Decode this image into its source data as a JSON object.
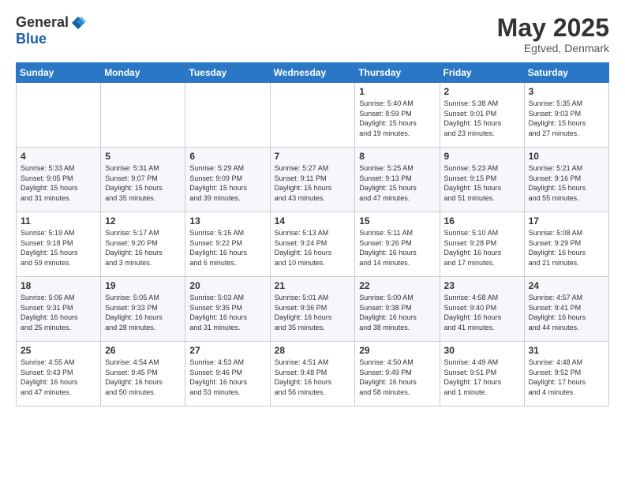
{
  "logo": {
    "general": "General",
    "blue": "Blue"
  },
  "title": {
    "month": "May 2025",
    "location": "Egtved, Denmark"
  },
  "headers": [
    "Sunday",
    "Monday",
    "Tuesday",
    "Wednesday",
    "Thursday",
    "Friday",
    "Saturday"
  ],
  "weeks": [
    [
      {
        "day": "",
        "info": ""
      },
      {
        "day": "",
        "info": ""
      },
      {
        "day": "",
        "info": ""
      },
      {
        "day": "",
        "info": ""
      },
      {
        "day": "1",
        "info": "Sunrise: 5:40 AM\nSunset: 8:59 PM\nDaylight: 15 hours\nand 19 minutes."
      },
      {
        "day": "2",
        "info": "Sunrise: 5:38 AM\nSunset: 9:01 PM\nDaylight: 15 hours\nand 23 minutes."
      },
      {
        "day": "3",
        "info": "Sunrise: 5:35 AM\nSunset: 9:03 PM\nDaylight: 15 hours\nand 27 minutes."
      }
    ],
    [
      {
        "day": "4",
        "info": "Sunrise: 5:33 AM\nSunset: 9:05 PM\nDaylight: 15 hours\nand 31 minutes."
      },
      {
        "day": "5",
        "info": "Sunrise: 5:31 AM\nSunset: 9:07 PM\nDaylight: 15 hours\nand 35 minutes."
      },
      {
        "day": "6",
        "info": "Sunrise: 5:29 AM\nSunset: 9:09 PM\nDaylight: 15 hours\nand 39 minutes."
      },
      {
        "day": "7",
        "info": "Sunrise: 5:27 AM\nSunset: 9:11 PM\nDaylight: 15 hours\nand 43 minutes."
      },
      {
        "day": "8",
        "info": "Sunrise: 5:25 AM\nSunset: 9:13 PM\nDaylight: 15 hours\nand 47 minutes."
      },
      {
        "day": "9",
        "info": "Sunrise: 5:23 AM\nSunset: 9:15 PM\nDaylight: 15 hours\nand 51 minutes."
      },
      {
        "day": "10",
        "info": "Sunrise: 5:21 AM\nSunset: 9:16 PM\nDaylight: 15 hours\nand 55 minutes."
      }
    ],
    [
      {
        "day": "11",
        "info": "Sunrise: 5:19 AM\nSunset: 9:18 PM\nDaylight: 15 hours\nand 59 minutes."
      },
      {
        "day": "12",
        "info": "Sunrise: 5:17 AM\nSunset: 9:20 PM\nDaylight: 16 hours\nand 3 minutes."
      },
      {
        "day": "13",
        "info": "Sunrise: 5:15 AM\nSunset: 9:22 PM\nDaylight: 16 hours\nand 6 minutes."
      },
      {
        "day": "14",
        "info": "Sunrise: 5:13 AM\nSunset: 9:24 PM\nDaylight: 16 hours\nand 10 minutes."
      },
      {
        "day": "15",
        "info": "Sunrise: 5:11 AM\nSunset: 9:26 PM\nDaylight: 16 hours\nand 14 minutes."
      },
      {
        "day": "16",
        "info": "Sunrise: 5:10 AM\nSunset: 9:28 PM\nDaylight: 16 hours\nand 17 minutes."
      },
      {
        "day": "17",
        "info": "Sunrise: 5:08 AM\nSunset: 9:29 PM\nDaylight: 16 hours\nand 21 minutes."
      }
    ],
    [
      {
        "day": "18",
        "info": "Sunrise: 5:06 AM\nSunset: 9:31 PM\nDaylight: 16 hours\nand 25 minutes."
      },
      {
        "day": "19",
        "info": "Sunrise: 5:05 AM\nSunset: 9:33 PM\nDaylight: 16 hours\nand 28 minutes."
      },
      {
        "day": "20",
        "info": "Sunrise: 5:03 AM\nSunset: 9:35 PM\nDaylight: 16 hours\nand 31 minutes."
      },
      {
        "day": "21",
        "info": "Sunrise: 5:01 AM\nSunset: 9:36 PM\nDaylight: 16 hours\nand 35 minutes."
      },
      {
        "day": "22",
        "info": "Sunrise: 5:00 AM\nSunset: 9:38 PM\nDaylight: 16 hours\nand 38 minutes."
      },
      {
        "day": "23",
        "info": "Sunrise: 4:58 AM\nSunset: 9:40 PM\nDaylight: 16 hours\nand 41 minutes."
      },
      {
        "day": "24",
        "info": "Sunrise: 4:57 AM\nSunset: 9:41 PM\nDaylight: 16 hours\nand 44 minutes."
      }
    ],
    [
      {
        "day": "25",
        "info": "Sunrise: 4:55 AM\nSunset: 9:43 PM\nDaylight: 16 hours\nand 47 minutes."
      },
      {
        "day": "26",
        "info": "Sunrise: 4:54 AM\nSunset: 9:45 PM\nDaylight: 16 hours\nand 50 minutes."
      },
      {
        "day": "27",
        "info": "Sunrise: 4:53 AM\nSunset: 9:46 PM\nDaylight: 16 hours\nand 53 minutes."
      },
      {
        "day": "28",
        "info": "Sunrise: 4:51 AM\nSunset: 9:48 PM\nDaylight: 16 hours\nand 56 minutes."
      },
      {
        "day": "29",
        "info": "Sunrise: 4:50 AM\nSunset: 9:49 PM\nDaylight: 16 hours\nand 58 minutes."
      },
      {
        "day": "30",
        "info": "Sunrise: 4:49 AM\nSunset: 9:51 PM\nDaylight: 17 hours\nand 1 minute."
      },
      {
        "day": "31",
        "info": "Sunrise: 4:48 AM\nSunset: 9:52 PM\nDaylight: 17 hours\nand 4 minutes."
      }
    ]
  ]
}
